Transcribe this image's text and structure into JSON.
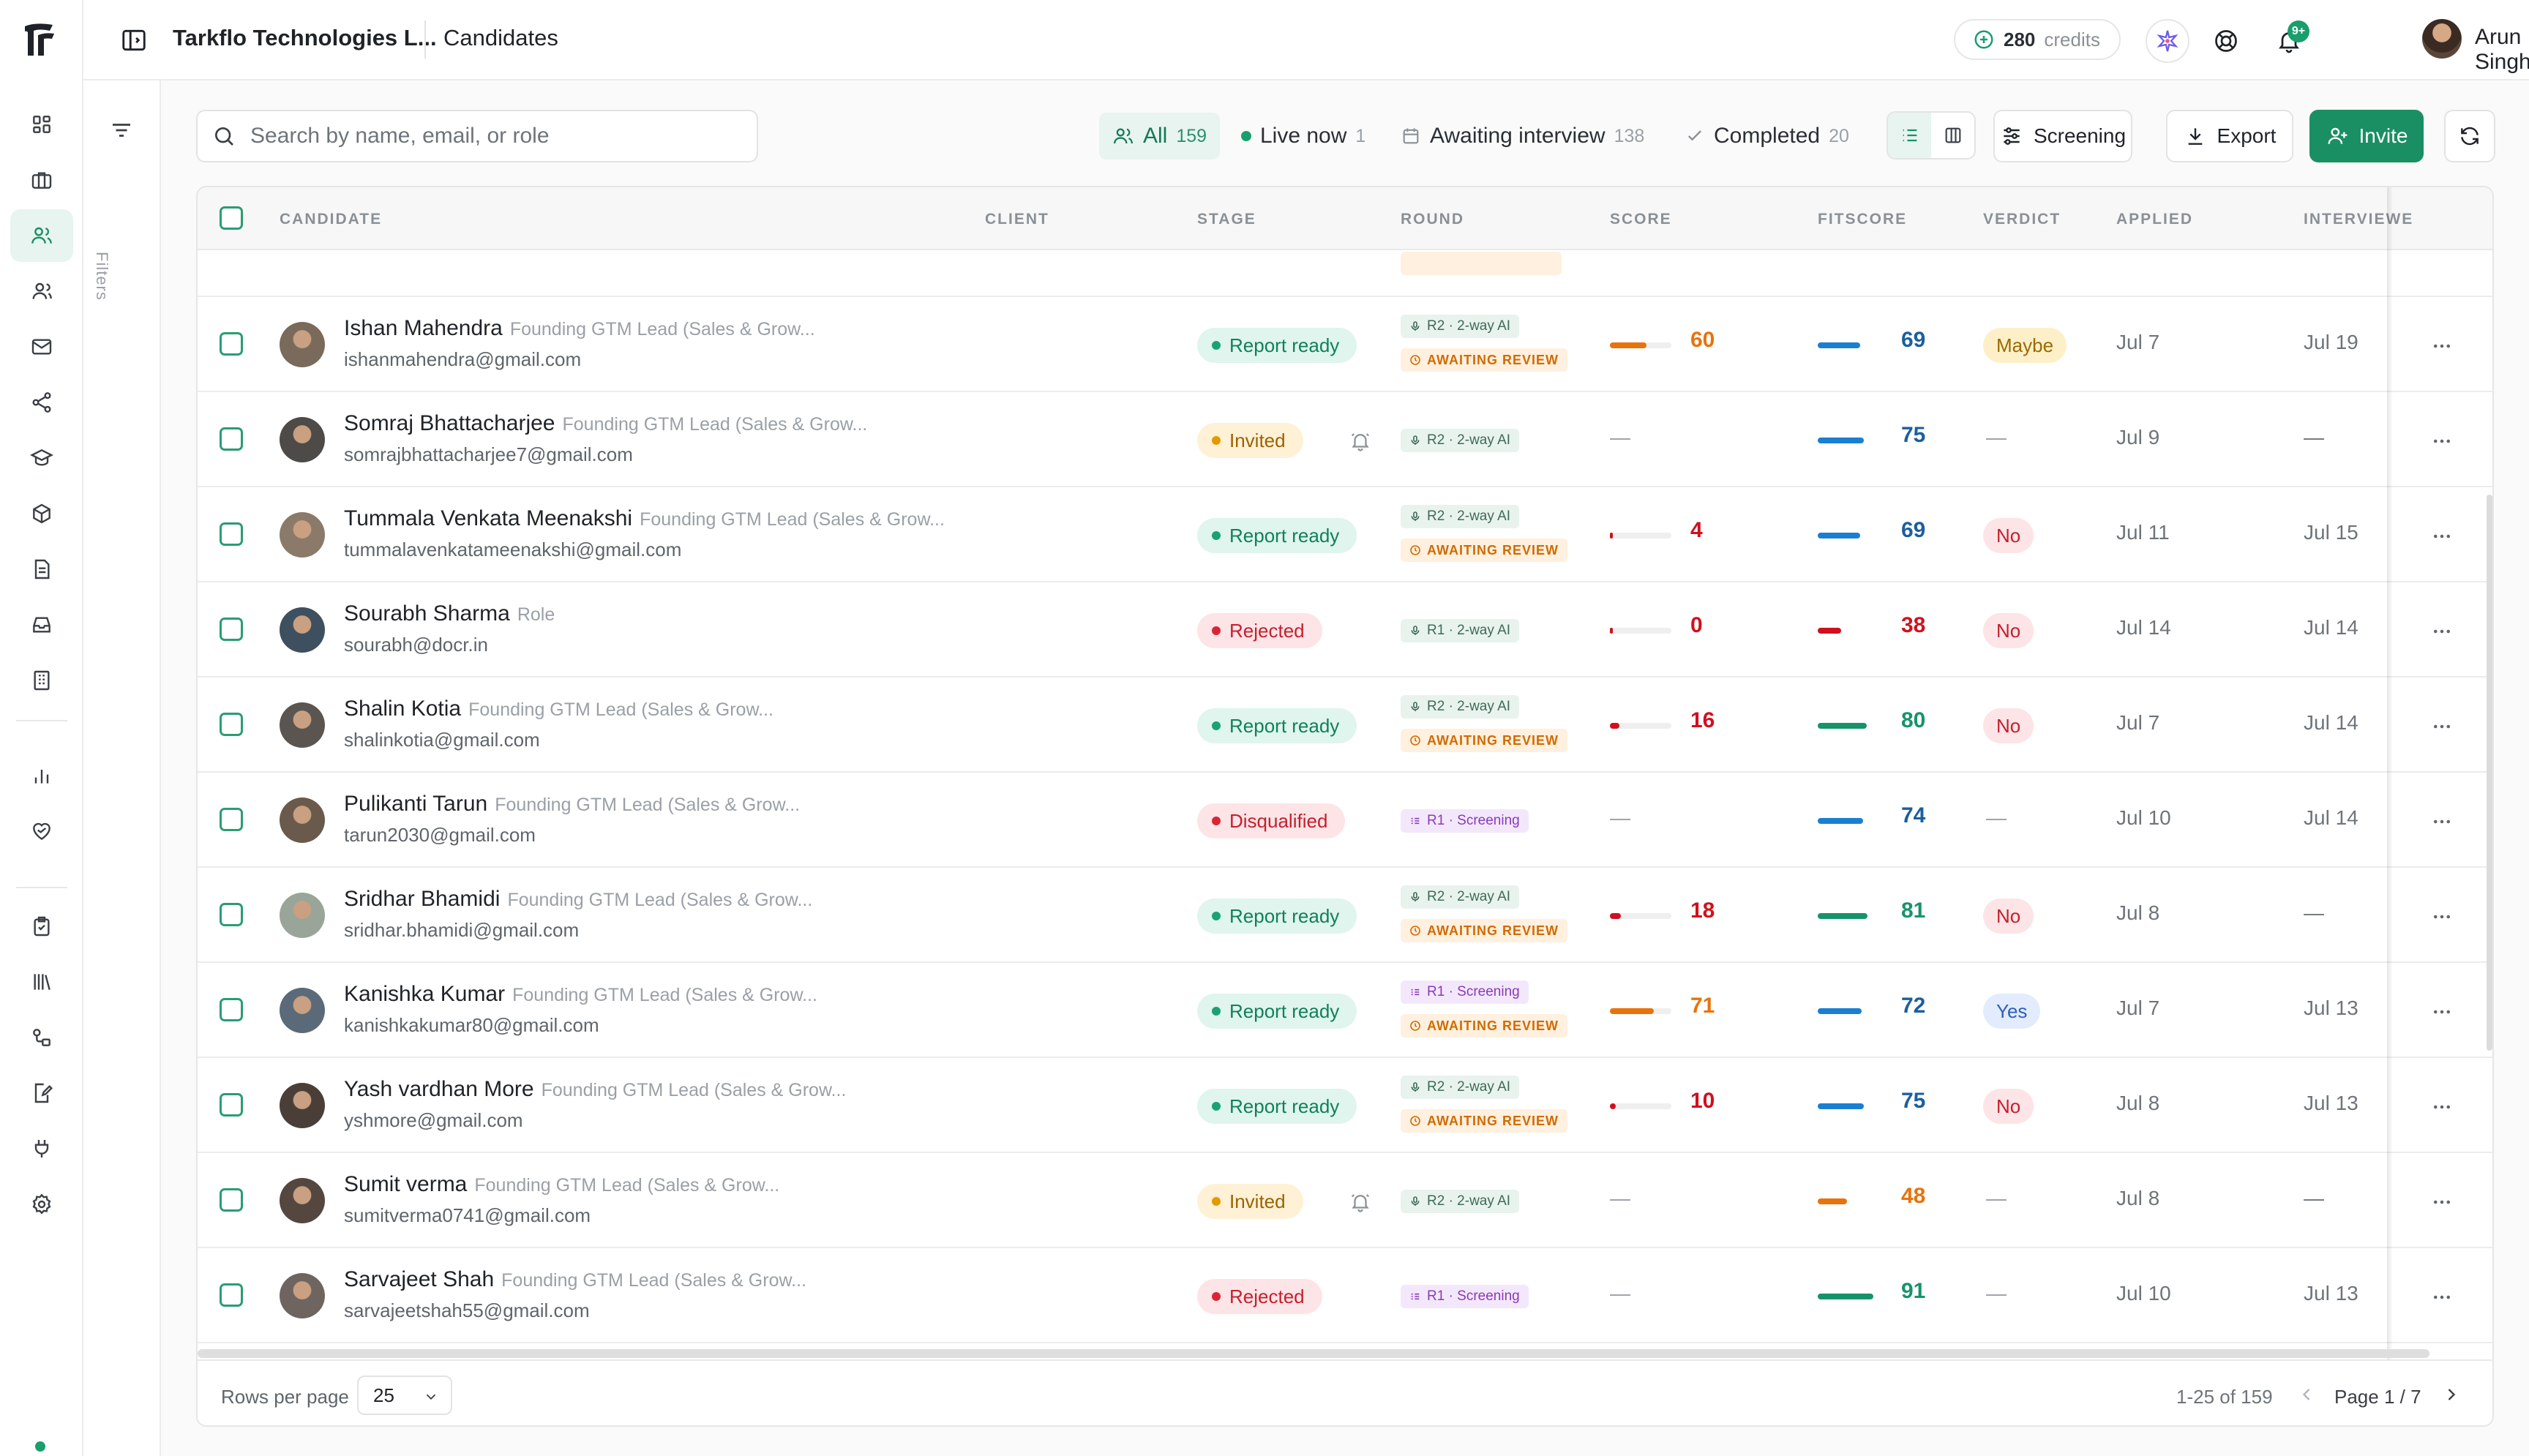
{
  "header": {
    "org_name": "Tarkflo Technologies L...",
    "page_title": "Candidates",
    "credits_value": "280",
    "credits_label": "credits",
    "notification_badge": "9+",
    "user_name": "Arun Singh"
  },
  "filters_label": "Filters",
  "search": {
    "placeholder": "Search by name, email, or role"
  },
  "segments": [
    {
      "label": "All",
      "count": "159"
    },
    {
      "label": "Live now",
      "count": "1"
    },
    {
      "label": "Awaiting interview",
      "count": "138"
    },
    {
      "label": "Completed",
      "count": "20"
    }
  ],
  "toolbar": {
    "screening_label": "Screening",
    "export_label": "Export",
    "invite_label": "Invite"
  },
  "columns": [
    "CANDIDATE",
    "CLIENT",
    "STAGE",
    "ROUND",
    "SCORE",
    "FITSCORE",
    "VERDICT",
    "APPLIED",
    "INTERVIEWE"
  ],
  "rows": [
    {
      "name": "Ishan Mahendra",
      "role": "Founding GTM Lead (Sales & Grow...",
      "email": "ishanmahendra@gmail.com",
      "stage": "Report ready",
      "round": "R2 · 2-way AI",
      "awaiting": "AWAITING REVIEW",
      "score": "60",
      "fitscore": "69",
      "verdict": "Maybe",
      "applied": "Jul 7",
      "interviewed": "Jul 19"
    },
    {
      "name": "Somraj Bhattacharjee",
      "role": "Founding GTM Lead (Sales & Grow...",
      "email": "somrajbhattacharjee7@gmail.com",
      "stage": "Invited",
      "round": "R2 · 2-way AI",
      "awaiting": "",
      "score": "—",
      "fitscore": "75",
      "verdict": "—",
      "applied": "Jul 9",
      "interviewed": "—"
    },
    {
      "name": "Tummala Venkata Meenakshi",
      "role": "Founding GTM Lead (Sales & Grow...",
      "email": "tummalavenkatameenakshi@gmail.com",
      "stage": "Report ready",
      "round": "R2 · 2-way AI",
      "awaiting": "AWAITING REVIEW",
      "score": "4",
      "fitscore": "69",
      "verdict": "No",
      "applied": "Jul 11",
      "interviewed": "Jul 15"
    },
    {
      "name": "Sourabh Sharma",
      "role": "Role",
      "email": "sourabh@docr.in",
      "stage": "Rejected",
      "round": "R1 · 2-way AI",
      "awaiting": "",
      "score": "0",
      "fitscore": "38",
      "verdict": "No",
      "applied": "Jul 14",
      "interviewed": "Jul 14"
    },
    {
      "name": "Shalin Kotia",
      "role": "Founding GTM Lead (Sales & Grow...",
      "email": "shalinkotia@gmail.com",
      "stage": "Report ready",
      "round": "R2 · 2-way AI",
      "awaiting": "AWAITING REVIEW",
      "score": "16",
      "fitscore": "80",
      "verdict": "No",
      "applied": "Jul 7",
      "interviewed": "Jul 14"
    },
    {
      "name": "Pulikanti Tarun",
      "role": "Founding GTM Lead (Sales & Grow...",
      "email": "tarun2030@gmail.com",
      "stage": "Disqualified",
      "round": "R1 · Screening",
      "awaiting": "",
      "score": "—",
      "fitscore": "74",
      "verdict": "—",
      "applied": "Jul 10",
      "interviewed": "Jul 14"
    },
    {
      "name": "Sridhar Bhamidi",
      "role": "Founding GTM Lead (Sales & Grow...",
      "email": "sridhar.bhamidi@gmail.com",
      "stage": "Report ready",
      "round": "R2 · 2-way AI",
      "awaiting": "AWAITING REVIEW",
      "score": "18",
      "fitscore": "81",
      "verdict": "No",
      "applied": "Jul 8",
      "interviewed": "—"
    },
    {
      "name": "Kanishka Kumar",
      "role": "Founding GTM Lead (Sales & Grow...",
      "email": "kanishkakumar80@gmail.com",
      "stage": "Report ready",
      "round": "R1 · Screening",
      "awaiting": "AWAITING REVIEW",
      "score": "71",
      "fitscore": "72",
      "verdict": "Yes",
      "applied": "Jul 7",
      "interviewed": "Jul 13"
    },
    {
      "name": "Yash vardhan More",
      "role": "Founding GTM Lead (Sales & Grow...",
      "email": "yshmore@gmail.com",
      "stage": "Report ready",
      "round": "R2 · 2-way AI",
      "awaiting": "AWAITING REVIEW",
      "score": "10",
      "fitscore": "75",
      "verdict": "No",
      "applied": "Jul 8",
      "interviewed": "Jul 13"
    },
    {
      "name": "Sumit verma",
      "role": "Founding GTM Lead (Sales & Grow...",
      "email": "sumitverma0741@gmail.com",
      "stage": "Invited",
      "round": "R2 · 2-way AI",
      "awaiting": "",
      "score": "—",
      "fitscore": "48",
      "verdict": "—",
      "applied": "Jul 8",
      "interviewed": "—"
    },
    {
      "name": "Sarvajeet Shah",
      "role": "Founding GTM Lead (Sales & Grow...",
      "email": "sarvajeetshah55@gmail.com",
      "stage": "Rejected",
      "round": "R1 · Screening",
      "awaiting": "",
      "score": "—",
      "fitscore": "91",
      "verdict": "—",
      "applied": "Jul 10",
      "interviewed": "Jul 13"
    }
  ],
  "colors": {
    "brand": "#1a8f63",
    "score_orange": "#e8730c",
    "score_red": "#d0101f",
    "fit_blue": "#1b7fd1",
    "fit_green": "#17936a"
  },
  "pagination": {
    "rows_per_page_label": "Rows per page",
    "rows_per_page": "25",
    "range": "1-25 of 159",
    "page": "Page 1 / 7"
  }
}
